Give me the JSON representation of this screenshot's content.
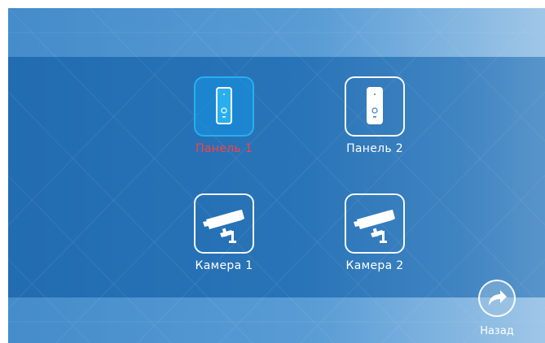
{
  "screen": {
    "background_color": "#2a73b5",
    "accent_color": "#29aef0",
    "selected_text_color": "#ff4040"
  },
  "tiles": [
    {
      "label": "Панель 1",
      "icon": "door-panel-icon",
      "selected": true
    },
    {
      "label": "Панель 2",
      "icon": "door-panel-icon",
      "selected": false
    },
    {
      "label": "Камера 1",
      "icon": "cctv-camera-icon",
      "selected": false
    },
    {
      "label": "Камера 2",
      "icon": "cctv-camera-icon",
      "selected": false
    }
  ],
  "back": {
    "label": "Назад",
    "icon": "back-arrow-icon"
  }
}
